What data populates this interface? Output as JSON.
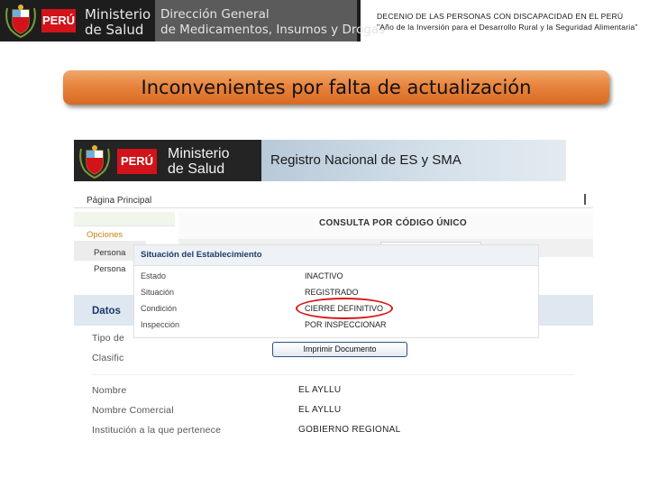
{
  "header": {
    "peru": "PERÚ",
    "ministerio_line1": "Ministerio",
    "ministerio_line2": "de Salud",
    "direccion_line1": "Dirección General",
    "direccion_line2": "de Medicamentos, Insumos y Drogas",
    "decree_line1": "DECENIO DE LAS PERSONAS CON DISCAPACIDAD EN EL PERÚ",
    "decree_line2": "\"Año de la Inversión para el Desarrollo Rural y la Seguridad Alimentaria\""
  },
  "title": "Inconvenientes por falta de actualización",
  "screenshot": {
    "peru": "PERÚ",
    "ministerio_line1": "Ministerio",
    "ministerio_line2": "de Salud",
    "registry": "Registro Nacional de ES y SMA",
    "nav_home": "Página Principal",
    "consulta": "CONSULTA POR CÓDIGO ÚNICO",
    "sidebar": {
      "options": "Opciones",
      "person1": "Persona",
      "person2": "Persona"
    },
    "situacion": {
      "title": "Situación del Establecimiento",
      "rows": [
        {
          "label": "Estado",
          "value": "INACTIVO"
        },
        {
          "label": "Situación",
          "value": "REGISTRADO"
        },
        {
          "label": "Condición",
          "value": "CIERRE DEFINITIVO"
        },
        {
          "label": "Inspección",
          "value": "POR INSPECCIONAR"
        }
      ]
    },
    "datos": "Datos",
    "tipo": "Tipo de",
    "clasif": "Clasific",
    "print_button": "Imprimir Documento",
    "info_rows": [
      {
        "label": "Nombre",
        "value": "EL AYLLU"
      },
      {
        "label": "Nombre Comercial",
        "value": "EL AYLLU"
      },
      {
        "label": "Institución a la que pertenece",
        "value": "GOBIERNO REGIONAL"
      }
    ]
  },
  "colors": {
    "title_bar": "#e8843e",
    "peru_red": "#d2131a",
    "highlight_oval": "#d81818"
  }
}
